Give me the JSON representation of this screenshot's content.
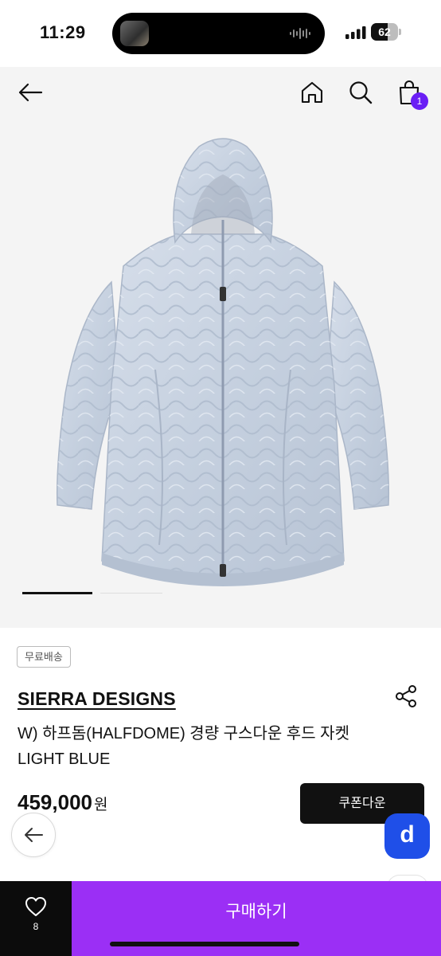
{
  "status_bar": {
    "time": "11:29",
    "battery_percent": 62,
    "battery_label": "62"
  },
  "nav": {
    "back_icon": "arrow-left-icon",
    "home_icon": "home-icon",
    "search_icon": "search-icon",
    "cart_icon": "shopping-bag-icon",
    "cart_count": "1"
  },
  "gallery": {
    "image_alt": "light-blue quilted hooded down jacket",
    "slide_count": 2,
    "active_slide": 1
  },
  "product": {
    "shipping_badge": "무료배송",
    "brand": "SIERRA DESIGNS",
    "title": "W) 하프돔(HALFDOME) 경량 구스다운 후드 자켓 LIGHT BLUE",
    "price": "459,000",
    "price_unit": "원",
    "coupon_label": "쿠폰다운",
    "share_icon": "share-icon"
  },
  "floating": {
    "back_icon": "arrow-left-icon",
    "app_letter": "d"
  },
  "bottom_bar": {
    "like_icon": "heart-icon",
    "like_count": "8",
    "buy_label": "구매하기"
  },
  "colors": {
    "accent_purple": "#9b2ff5",
    "badge_purple": "#6a1ef5",
    "app_blue": "#1f4fe8",
    "dark": "#0c0c0c",
    "gallery_bg": "#f4f4f4",
    "jacket": "#c9d4e3"
  }
}
